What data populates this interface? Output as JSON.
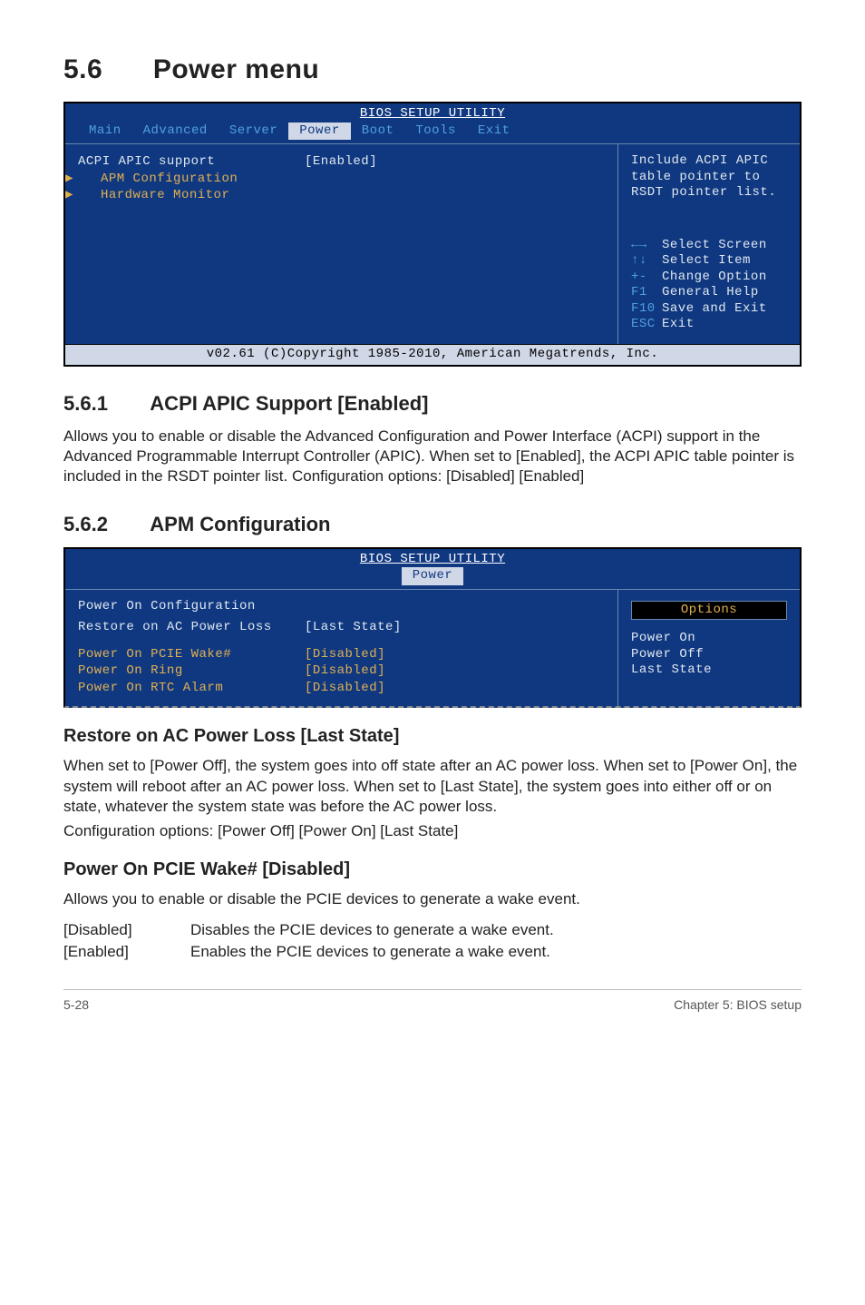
{
  "section": {
    "number": "5.6",
    "title": "Power menu"
  },
  "bios1": {
    "title": "BIOS SETUP UTILITY",
    "tabs": [
      "Main",
      "Advanced",
      "Server",
      "Power",
      "Boot",
      "Tools",
      "Exit"
    ],
    "active_tab": 3,
    "rows": [
      {
        "label": "ACPI APIC support",
        "value": "[Enabled]",
        "hi": true
      },
      {
        "label": "APM Configuration",
        "value": "",
        "sub": true
      },
      {
        "label": "Hardware Monitor",
        "value": "",
        "sub": true
      }
    ],
    "help_top": [
      "Include ACPI APIC",
      "table pointer to",
      "RSDT pointer list."
    ],
    "nav": [
      {
        "key": "←→",
        "text": "Select Screen"
      },
      {
        "key": "↑↓",
        "text": "Select Item"
      },
      {
        "key": "+-",
        "text": "Change Option"
      },
      {
        "key": "F1",
        "text": "General Help"
      },
      {
        "key": "F10",
        "text": "Save and Exit"
      },
      {
        "key": "ESC",
        "text": "Exit"
      }
    ],
    "footer": "v02.61 (C)Copyright 1985-2010, American Megatrends, Inc."
  },
  "sub561": {
    "number": "5.6.1",
    "title": "ACPI APIC Support [Enabled]",
    "body": "Allows you to enable or disable the Advanced Configuration and Power Interface (ACPI) support in the Advanced Programmable Interrupt Controller (APIC). When set to [Enabled], the ACPI APIC table pointer is included in the RSDT pointer list. Configuration options: [Disabled] [Enabled]"
  },
  "sub562": {
    "number": "5.6.2",
    "title": "APM Configuration"
  },
  "bios2": {
    "title": "BIOS SETUP UTILITY",
    "tab": "Power",
    "subtitle": "Power On Configuration",
    "rows": [
      {
        "label": "Restore on AC Power Loss",
        "value": "[Last State]",
        "hi": true
      },
      {
        "label": "Power On PCIE Wake#",
        "value": "[Disabled]"
      },
      {
        "label": "Power On Ring",
        "value": "[Disabled]"
      },
      {
        "label": "Power On RTC Alarm",
        "value": "[Disabled]"
      }
    ],
    "options_banner": "Options",
    "options": [
      "Power On",
      "Power Off",
      "Last State"
    ]
  },
  "restore": {
    "title": "Restore on AC Power Loss [Last State]",
    "body1": "When set to [Power Off], the system goes into off state after an AC power loss. When set to [Power On], the system will reboot after an AC power loss. When set to [Last State], the system goes into either off or on state, whatever the system state was before the AC power loss.",
    "body2": "Configuration options: [Power Off] [Power On] [Last State]"
  },
  "pcie": {
    "title": "Power On PCIE Wake# [Disabled]",
    "body": "Allows you to enable or disable the PCIE devices to generate a wake event.",
    "defs": [
      {
        "k": "[Disabled]",
        "v": "Disables the PCIE devices to generate a wake event."
      },
      {
        "k": "[Enabled]",
        "v": "Enables the PCIE devices to generate a wake event."
      }
    ]
  },
  "footer": {
    "left": "5-28",
    "right": "Chapter 5: BIOS setup"
  }
}
